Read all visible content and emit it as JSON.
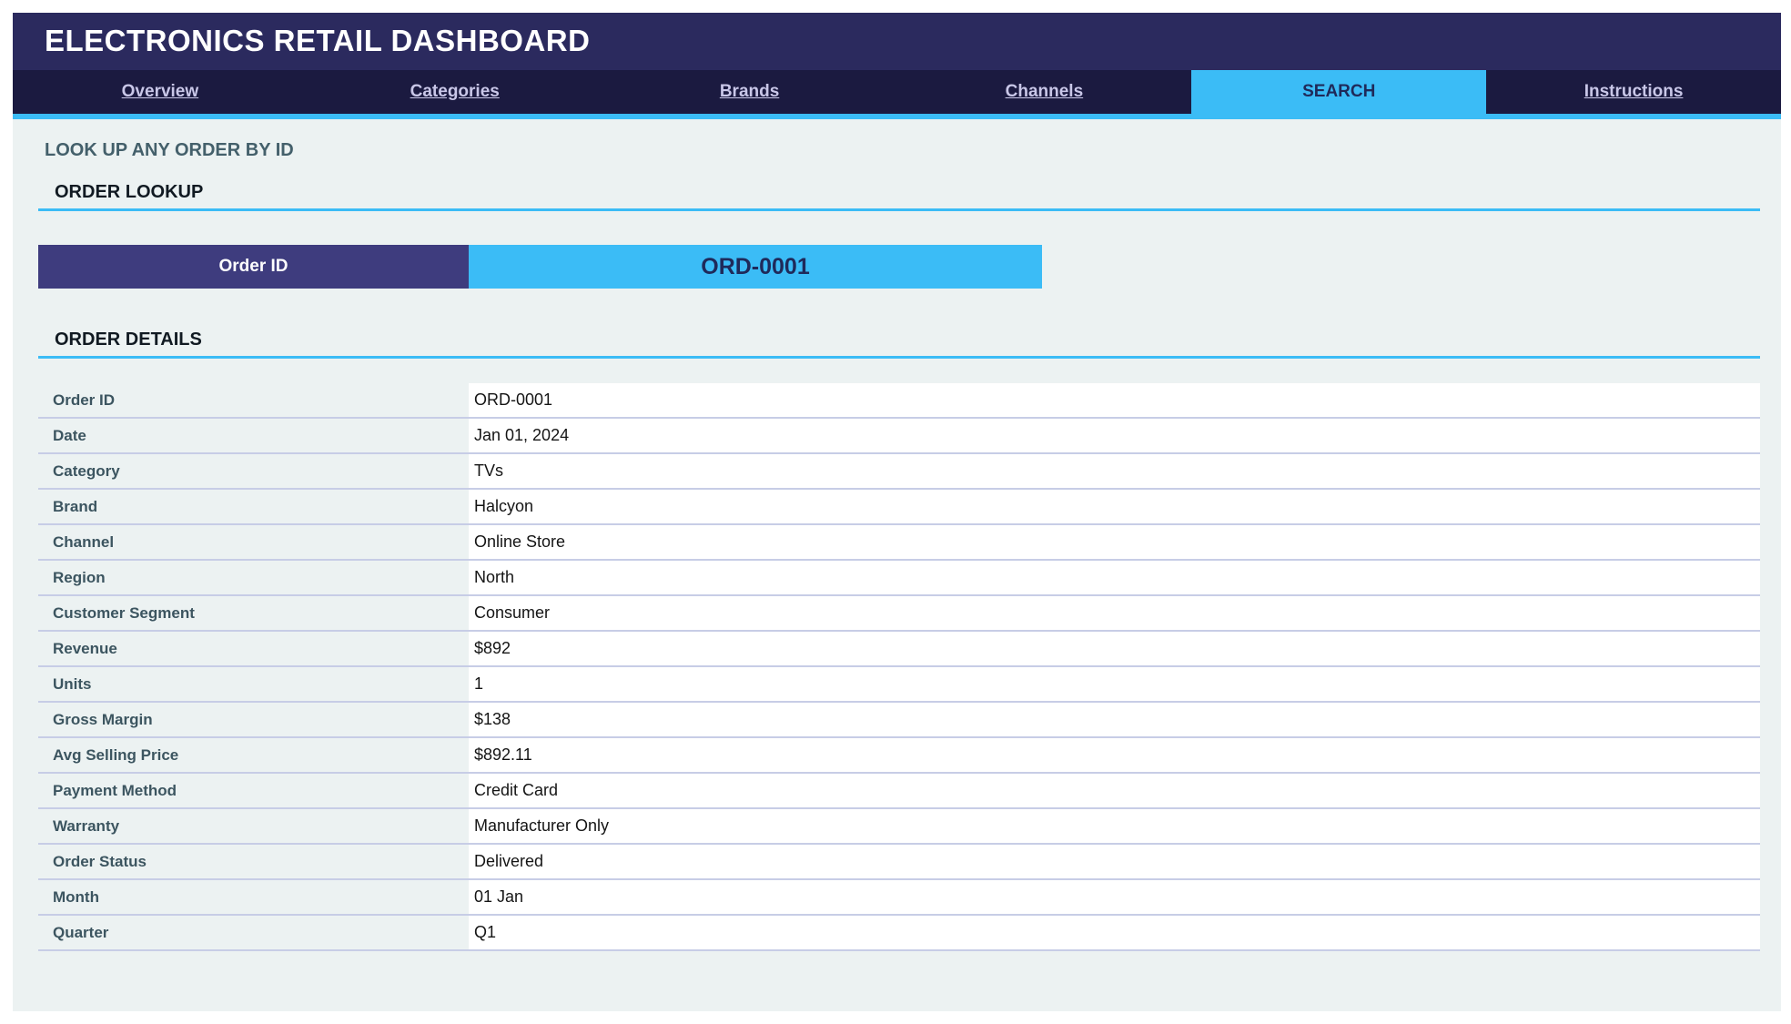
{
  "header": {
    "title": "ELECTRONICS RETAIL DASHBOARD"
  },
  "tabs": [
    {
      "label": "Overview",
      "active": false
    },
    {
      "label": "Categories",
      "active": false
    },
    {
      "label": "Brands",
      "active": false
    },
    {
      "label": "Channels",
      "active": false
    },
    {
      "label": "SEARCH",
      "active": true
    },
    {
      "label": "Instructions",
      "active": false
    }
  ],
  "page": {
    "subtitle": "LOOK UP ANY ORDER BY ID",
    "lookup_heading": "ORDER LOOKUP",
    "details_heading": "ORDER DETAILS"
  },
  "lookup": {
    "label": "Order ID",
    "value": "ORD-0001"
  },
  "details": [
    {
      "label": "Order ID",
      "value": "ORD-0001"
    },
    {
      "label": "Date",
      "value": "Jan 01, 2024"
    },
    {
      "label": "Category",
      "value": "TVs"
    },
    {
      "label": "Brand",
      "value": "Halcyon"
    },
    {
      "label": "Channel",
      "value": "Online Store"
    },
    {
      "label": "Region",
      "value": "North"
    },
    {
      "label": "Customer Segment",
      "value": "Consumer"
    },
    {
      "label": "Revenue",
      "value": "$892"
    },
    {
      "label": "Units",
      "value": "1"
    },
    {
      "label": "Gross Margin",
      "value": "$138"
    },
    {
      "label": "Avg Selling Price",
      "value": "$892.11"
    },
    {
      "label": "Payment Method",
      "value": "Credit Card"
    },
    {
      "label": "Warranty",
      "value": "Manufacturer Only"
    },
    {
      "label": "Order Status",
      "value": "Delivered"
    },
    {
      "label": "Month",
      "value": "01 Jan"
    },
    {
      "label": "Quarter",
      "value": "Q1"
    }
  ],
  "colors": {
    "header_bg": "#2b2a5e",
    "tabbar_bg": "#1b1a40",
    "accent": "#3bbcf6",
    "label_bg": "#3e3c7e",
    "page_bg": "#ecf2f2"
  }
}
